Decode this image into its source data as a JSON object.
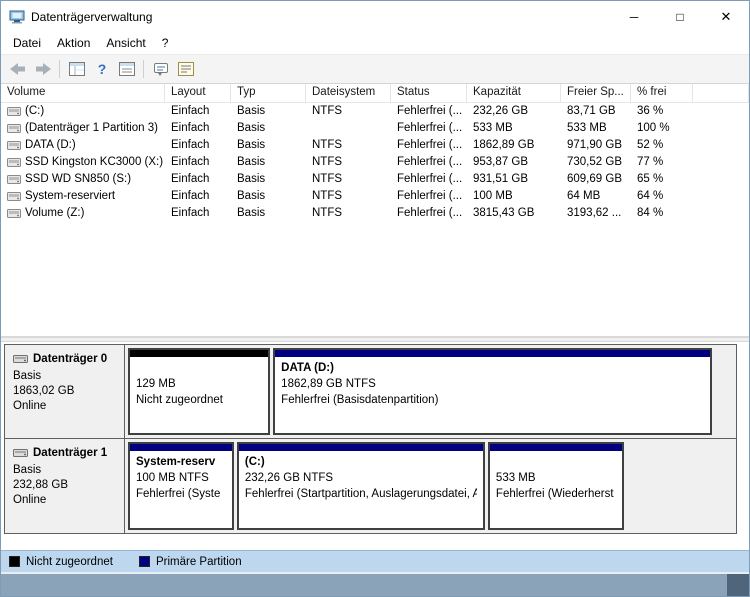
{
  "window": {
    "title": "Datenträgerverwaltung",
    "controls": {
      "minimize": "─",
      "maximize": "□",
      "close": "✕"
    }
  },
  "menu": {
    "items": [
      "Datei",
      "Aktion",
      "Ansicht",
      "?"
    ]
  },
  "toolbar": {
    "icons": [
      "back-icon",
      "forward-icon",
      "console-tree-icon",
      "help-icon",
      "properties-icon",
      "action-pane-icon",
      "legend-list-icon"
    ]
  },
  "volume_list": {
    "columns": [
      "Volume",
      "Layout",
      "Typ",
      "Dateisystem",
      "Status",
      "Kapazität",
      "Freier Sp...",
      "% frei"
    ],
    "rows": [
      [
        "(C:)",
        "Einfach",
        "Basis",
        "NTFS",
        "Fehlerfrei (...",
        "232,26 GB",
        "83,71 GB",
        "36 %"
      ],
      [
        "(Datenträger 1 Partition 3)",
        "Einfach",
        "Basis",
        "",
        "Fehlerfrei (...",
        "533 MB",
        "533 MB",
        "100 %"
      ],
      [
        "DATA (D:)",
        "Einfach",
        "Basis",
        "NTFS",
        "Fehlerfrei (...",
        "1862,89 GB",
        "971,90 GB",
        "52 %"
      ],
      [
        "SSD Kingston KC3000 (X:)",
        "Einfach",
        "Basis",
        "NTFS",
        "Fehlerfrei (...",
        "953,87 GB",
        "730,52 GB",
        "77 %"
      ],
      [
        "SSD WD SN850 (S:)",
        "Einfach",
        "Basis",
        "NTFS",
        "Fehlerfrei (...",
        "931,51 GB",
        "609,69 GB",
        "65 %"
      ],
      [
        "System-reserviert",
        "Einfach",
        "Basis",
        "NTFS",
        "Fehlerfrei (...",
        "100 MB",
        "64 MB",
        "64 %"
      ],
      [
        "Volume (Z:)",
        "Einfach",
        "Basis",
        "NTFS",
        "Fehlerfrei (...",
        "3815,43 GB",
        "3193,62 ...",
        "84 %"
      ]
    ]
  },
  "disks": [
    {
      "name": "Datenträger 0",
      "type": "Basis",
      "size": "1863,02 GB",
      "status": "Online",
      "partitions": [
        {
          "kind": "unallocated",
          "title": "",
          "line1": "129 MB",
          "line2": "Nicht zugeordnet"
        },
        {
          "kind": "primary",
          "title": "DATA (D:)",
          "line1": "1862,89 GB NTFS",
          "line2": "Fehlerfrei (Basisdatenpartition)"
        }
      ]
    },
    {
      "name": "Datenträger 1",
      "type": "Basis",
      "size": "232,88 GB",
      "status": "Online",
      "partitions": [
        {
          "kind": "primary",
          "title": "System-reserv",
          "line1": "100 MB NTFS",
          "line2": "Fehlerfrei (Syste"
        },
        {
          "kind": "primary",
          "title": "(C:)",
          "line1": "232,26 GB NTFS",
          "line2": "Fehlerfrei (Startpartition, Auslagerungsdatei, Ab"
        },
        {
          "kind": "primary",
          "title": "",
          "line1": "533 MB",
          "line2": "Fehlerfrei (Wiederherst"
        }
      ]
    }
  ],
  "legend": {
    "items": [
      {
        "label": "Nicht zugeordnet",
        "color": "#000000"
      },
      {
        "label": "Primäre Partition",
        "color": "#000080"
      }
    ]
  },
  "colors": {
    "primary_partition": "#000080",
    "unallocated": "#000000",
    "legend_bar": "#bcd7ee"
  }
}
